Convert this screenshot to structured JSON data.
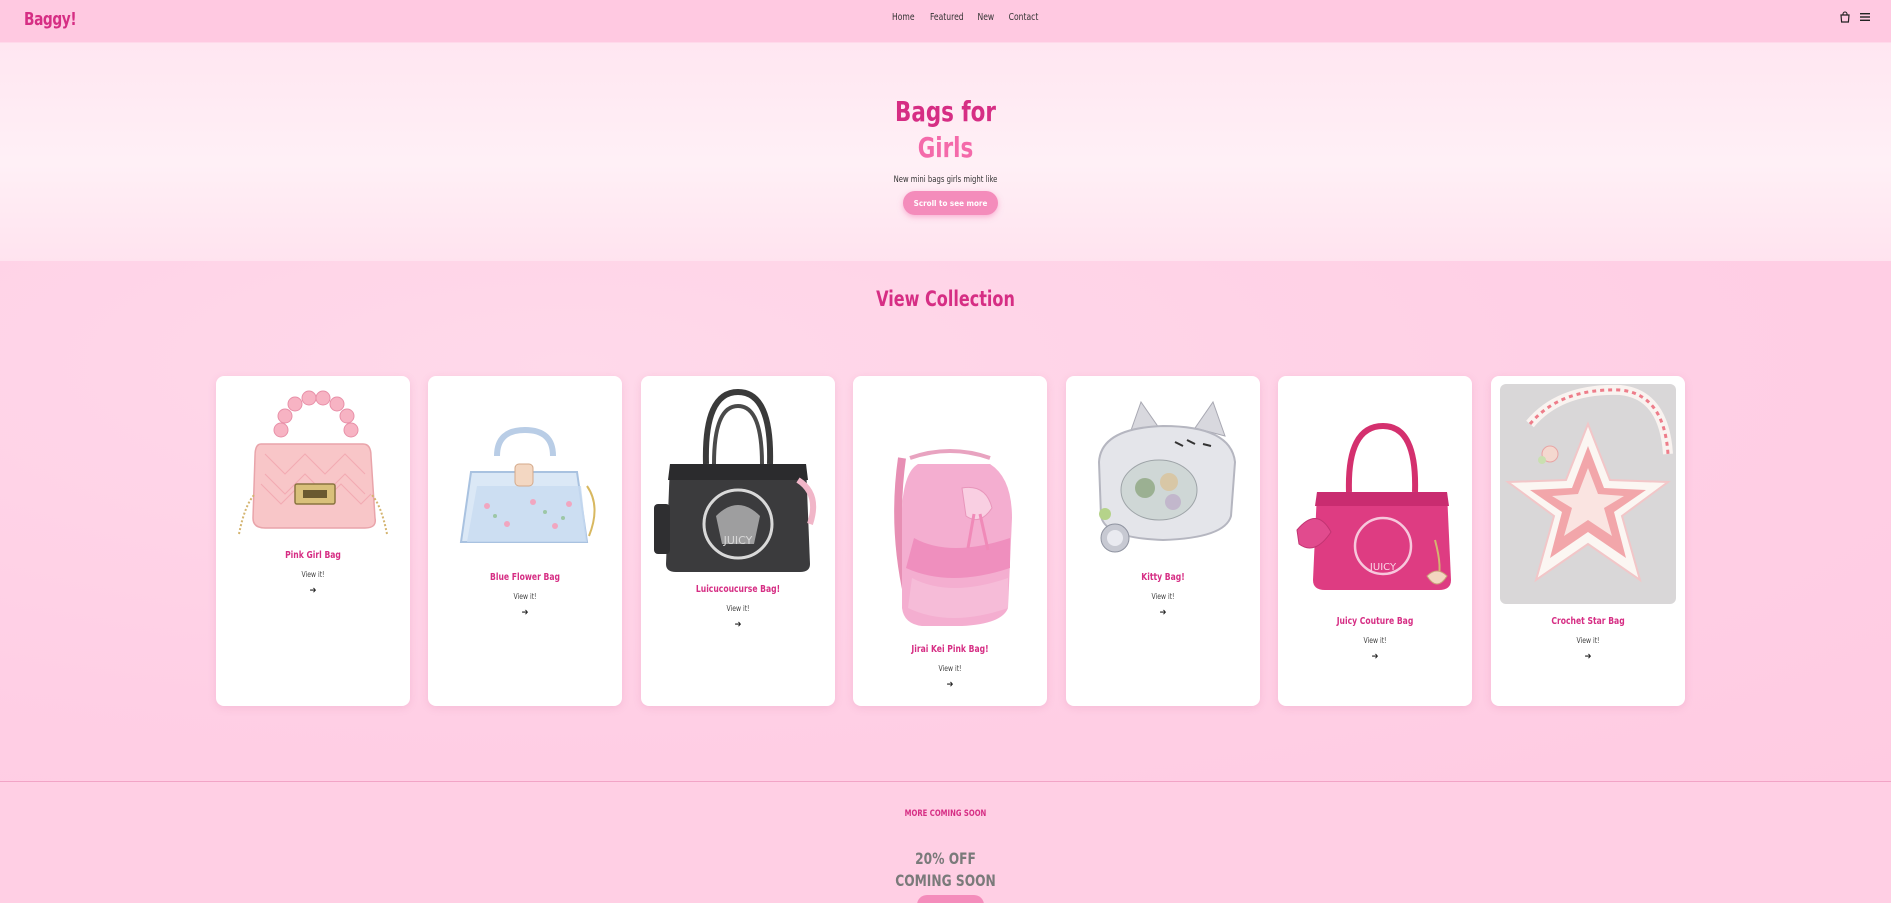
{
  "nav": {
    "logo": "Baggy!",
    "links": [
      "Home",
      "Featured",
      "New",
      "Contact"
    ],
    "icons": [
      "bag-icon",
      "menu-icon"
    ]
  },
  "hero": {
    "title_line1": "Bags for",
    "title_line2": "Girls",
    "subtitle": "New mini bags girls might like",
    "button": "Scroll to see more"
  },
  "collection": {
    "title": "View Collection",
    "view_label": "View it!",
    "arrow": "➔",
    "items": [
      {
        "name": "Pink Girl Bag",
        "img": "pink-jelly-bag-image"
      },
      {
        "name": "Blue Flower Bag",
        "img": "blue-clear-bag-image"
      },
      {
        "name": "Luicucoucurse Bag!",
        "img": "black-juicy-bag-image"
      },
      {
        "name": "Jirai Kei Pink Bag!",
        "img": "pink-ruffle-backpack-image"
      },
      {
        "name": "Kitty Bag!",
        "img": "silver-kitty-bag-image"
      },
      {
        "name": "Juicy Couture Bag",
        "img": "pink-juicy-bag-image"
      },
      {
        "name": "Crochet Star Bag",
        "img": "crochet-star-bag-image"
      }
    ]
  },
  "promo": {
    "label": "MORE COMING SOON",
    "offer_line1": "20% OFF",
    "offer_line2": "COMING SOON"
  },
  "colors": {
    "accent": "#d62e84",
    "accent_light": "#f46aaa",
    "button": "#f48cbb",
    "background": "#ffd0e6"
  }
}
